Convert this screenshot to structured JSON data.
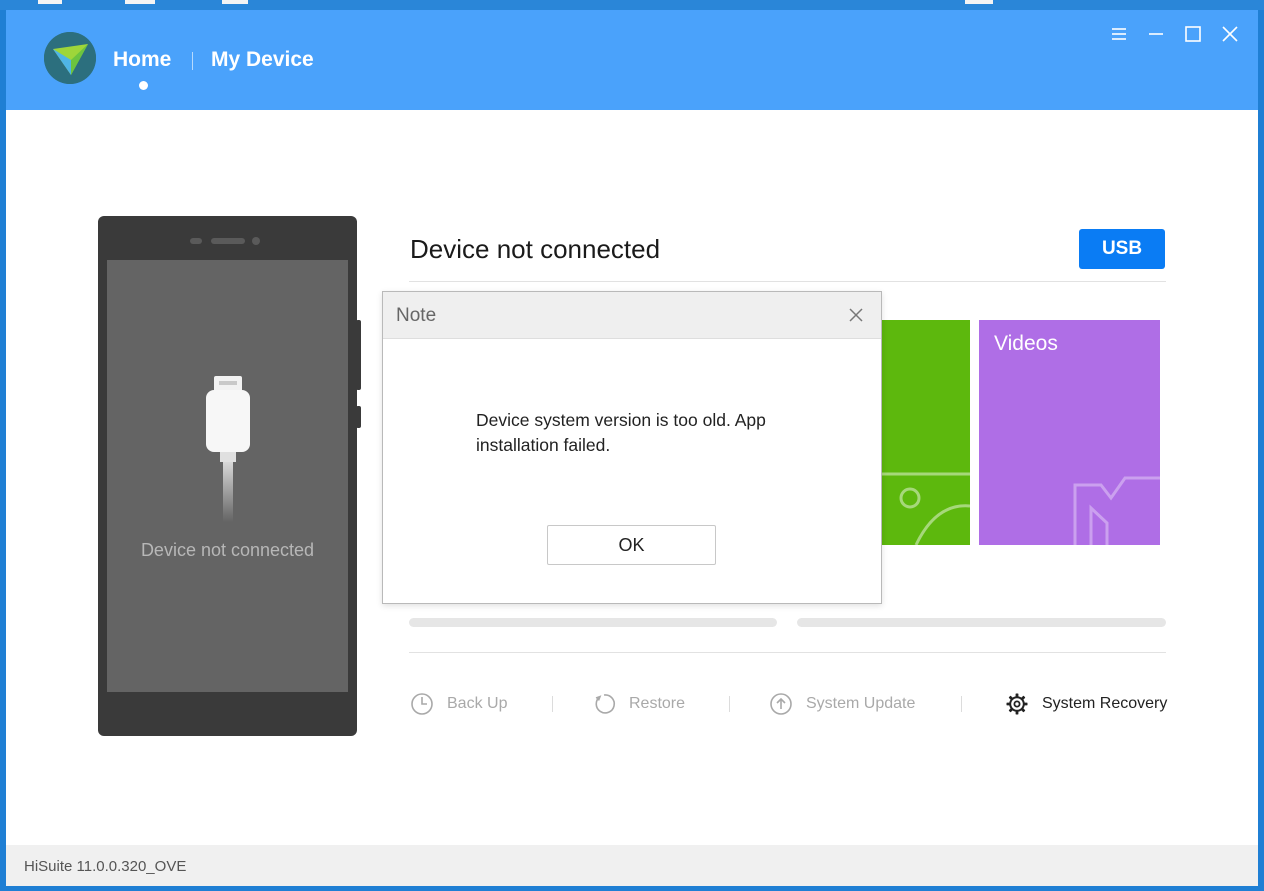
{
  "nav": {
    "home": "Home",
    "my_device": "My Device"
  },
  "status": {
    "title": "Device not connected",
    "usb_button": "USB"
  },
  "phone": {
    "status_text": "Device not connected"
  },
  "tiles": [
    {
      "label": ""
    },
    {
      "label": "Videos"
    }
  ],
  "actions": [
    {
      "label": "Back Up",
      "enabled": false,
      "icon": "backup-icon"
    },
    {
      "label": "Restore",
      "enabled": false,
      "icon": "restore-icon"
    },
    {
      "label": "System Update",
      "enabled": false,
      "icon": "system-update-icon"
    },
    {
      "label": "System Recovery",
      "enabled": true,
      "icon": "gear-icon"
    }
  ],
  "dialog": {
    "title": "Note",
    "message": "Device system version is too old. App installation failed.",
    "ok_label": "OK"
  },
  "footer": {
    "version": "HiSuite 11.0.0.320_OVE"
  },
  "colors": {
    "titlebar": "#4aa2fb",
    "usb_button": "#0a7cf4",
    "tile_green": "#5db80d",
    "tile_purple": "#af6ee6"
  }
}
